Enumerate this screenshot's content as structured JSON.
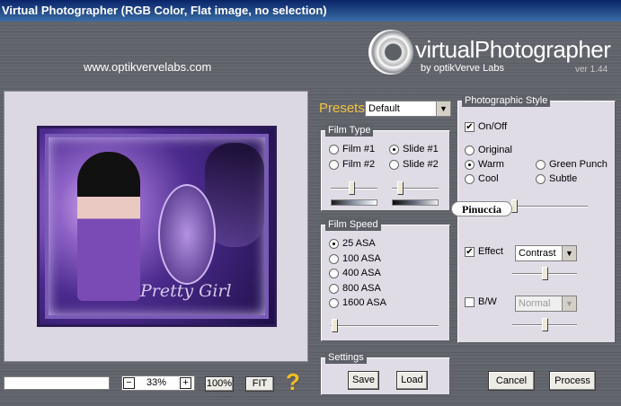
{
  "window": {
    "title": "Virtual Photographer (RGB Color, Flat image, no selection)"
  },
  "branding": {
    "website": "www.optikvervelabs.com",
    "name": "virtualPhotographer",
    "by": "by optikVerve Labs",
    "version": "ver 1.44",
    "image_watermark": "Pretty Girl"
  },
  "presets": {
    "label": "Presets",
    "selected": "Default"
  },
  "film_type": {
    "title": "Film Type",
    "options": [
      {
        "label": "Film #1",
        "selected": false
      },
      {
        "label": "Slide #1",
        "selected": true
      },
      {
        "label": "Film #2",
        "selected": false
      },
      {
        "label": "Slide #2",
        "selected": false
      }
    ],
    "slider_left_value": 0.44,
    "slider_right_value": 0.18
  },
  "film_speed": {
    "title": "Film Speed",
    "options": [
      {
        "label": "25 ASA",
        "selected": true
      },
      {
        "label": "100 ASA",
        "selected": false
      },
      {
        "label": "400 ASA",
        "selected": false
      },
      {
        "label": "800 ASA",
        "selected": false
      },
      {
        "label": "1600 ASA",
        "selected": false
      }
    ],
    "slider_value": 0.03
  },
  "photographic_style": {
    "title": "Photographic Style",
    "on_off_label": "On/Off",
    "on_off_checked": true,
    "options": [
      {
        "label": "Original",
        "selected": false
      },
      {
        "label": "Warm",
        "selected": true
      },
      {
        "label": "Green Punch",
        "selected": false
      },
      {
        "label": "Cool",
        "selected": false
      },
      {
        "label": "Subtle",
        "selected": false
      }
    ],
    "style_slider_value": 0.27,
    "badge_text": "Pinuccia",
    "effect_label": "Effect",
    "effect_checked": true,
    "effect_selected": "Contrast",
    "effect_slider_value": 0.5,
    "bw_label": "B/W",
    "bw_checked": false,
    "bw_selected": "Normal",
    "bw_slider_value": 0.5
  },
  "settings": {
    "title": "Settings",
    "save_label": "Save",
    "load_label": "Load"
  },
  "zoom": {
    "minus": "−",
    "value": "33%",
    "plus": "+",
    "hundred_label": "100%",
    "fit_label": "FIT",
    "help_glyph": "?"
  },
  "actions": {
    "cancel_label": "Cancel",
    "process_label": "Process"
  },
  "icons": {
    "logo": "aperture-logo-icon",
    "help": "question-mark-icon"
  }
}
